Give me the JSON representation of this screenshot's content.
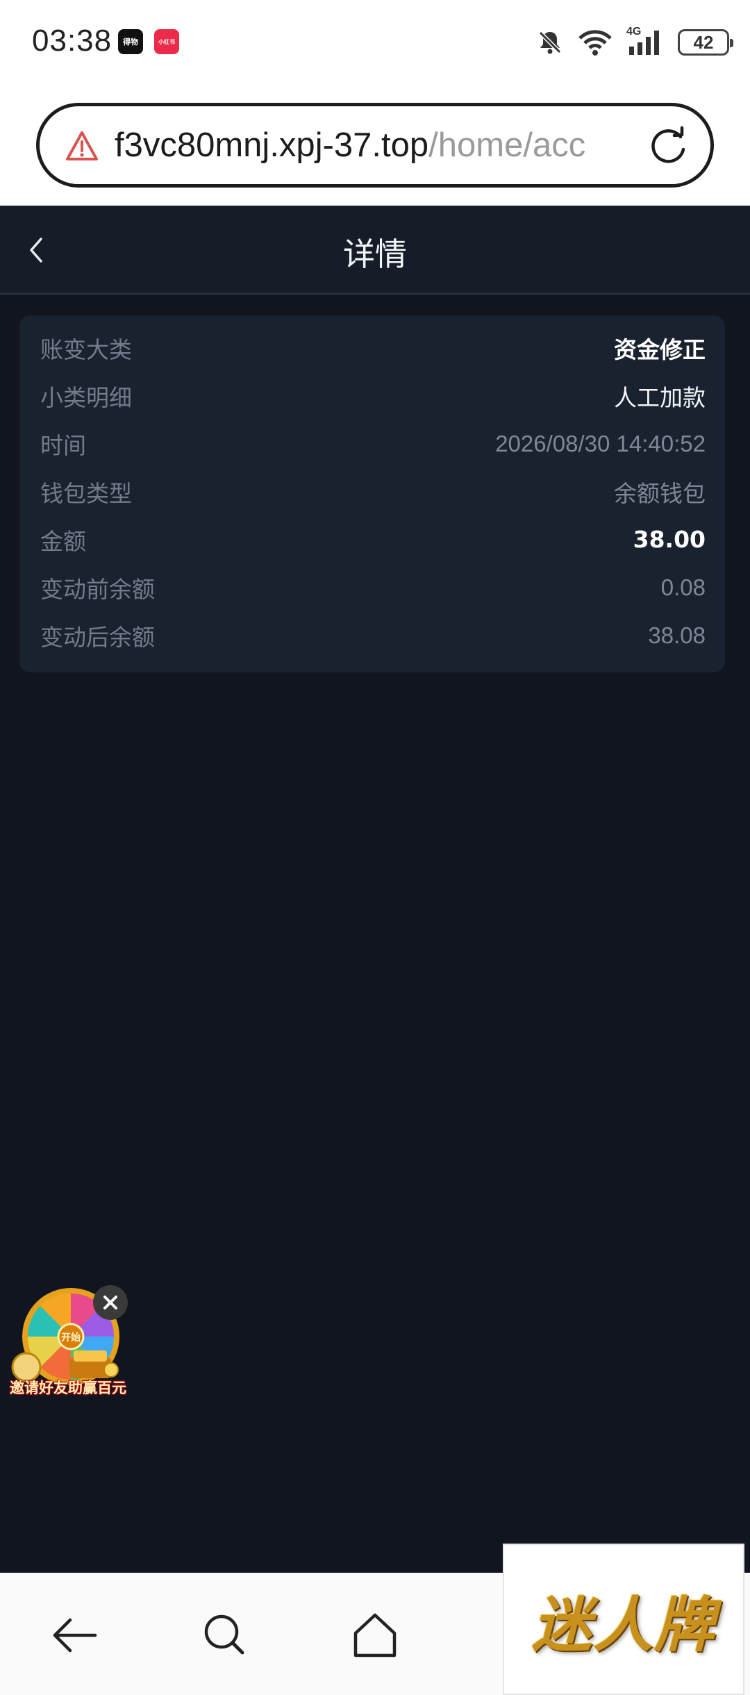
{
  "status_bar": {
    "time": "03:38",
    "badges": [
      "得物",
      "小红书"
    ],
    "network": "4G",
    "battery": "42"
  },
  "browser": {
    "url_host": "f3vc80mnj.xpj-37.top",
    "url_path": "/home/acc"
  },
  "header": {
    "title": "详情"
  },
  "detail": {
    "rows": [
      {
        "label": "账变大类",
        "value": "资金修正"
      },
      {
        "label": "小类明细",
        "value": "人工加款"
      },
      {
        "label": "时间",
        "value": "2026/08/30 14:40:52"
      },
      {
        "label": "钱包类型",
        "value": "余额钱包"
      },
      {
        "label": "金额",
        "value": "38.00"
      },
      {
        "label": "变动前余额",
        "value": "0.08"
      },
      {
        "label": "变动后余额",
        "value": "38.08"
      }
    ]
  },
  "promo": {
    "text": "邀请好友助赢百元",
    "wheel_center": "开始"
  },
  "watermark": {
    "text": "迷人牌"
  },
  "colors": {
    "page_bg": "#111520",
    "card_bg": "#1a2230",
    "header_bg": "#161d29",
    "label": "#737c8c",
    "warning": "#d9534f"
  }
}
